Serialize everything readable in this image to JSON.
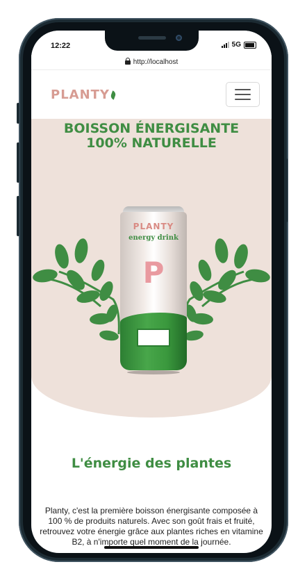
{
  "status_bar": {
    "time": "12:22",
    "network": "5G"
  },
  "browser": {
    "url": "http://localhost"
  },
  "navbar": {
    "logo_text": "PLANTY",
    "menu_icon": "hamburger-icon"
  },
  "hero": {
    "title_line1": "BOISSON ÉNERGISANTE",
    "title_line2": "100% NATURELLE",
    "can": {
      "brand": "PLANTY",
      "subtitle": "energy drink",
      "letter": "P"
    }
  },
  "section": {
    "title": "L'énergie des plantes",
    "text": "Planty, c'est la première boisson énergisante composée à 100 % de produits naturels. Avec son goût frais et fruité, retrouvez votre énergie grâce aux plantes riches en vitamine B2, à n'importe quel moment de la journée."
  },
  "colors": {
    "accent_green": "#3f8d43",
    "logo_pink": "#d79c93",
    "hero_background": "#eee1da"
  }
}
